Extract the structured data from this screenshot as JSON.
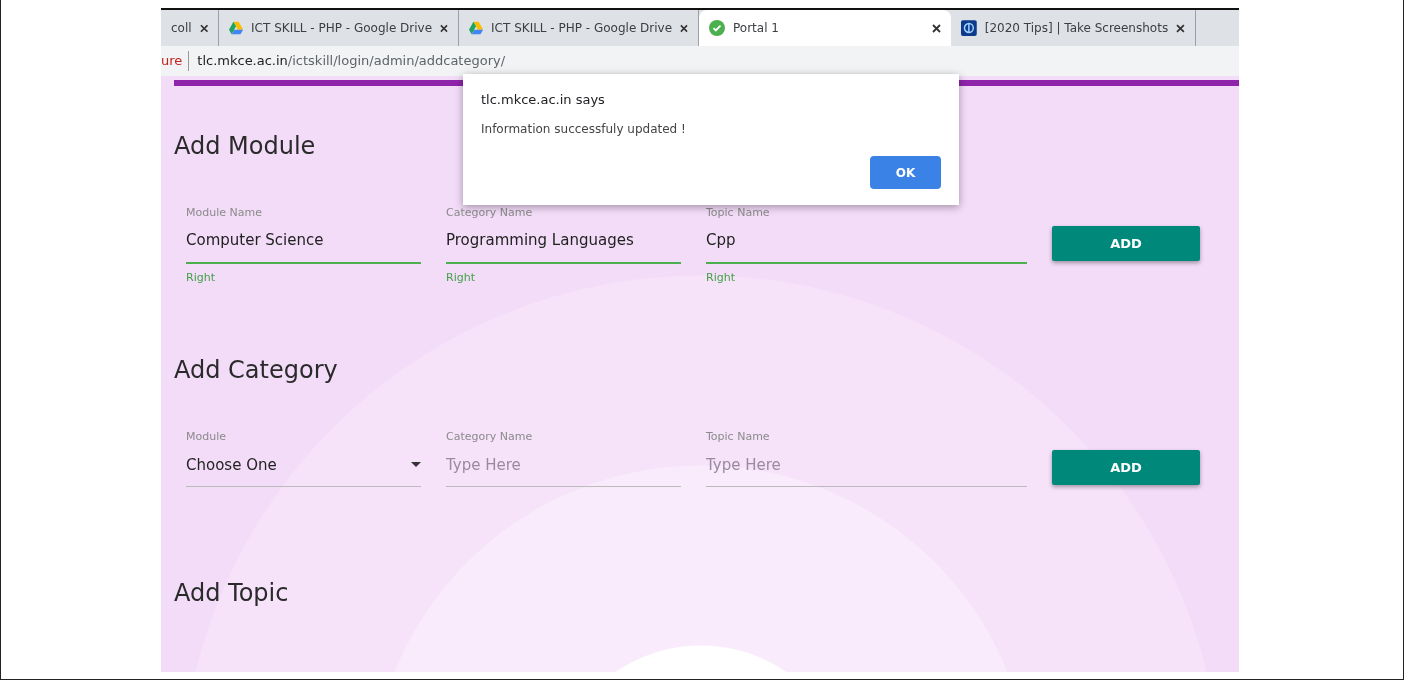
{
  "tabs": [
    {
      "title": "coll",
      "kind": "plain",
      "selected": false
    },
    {
      "title": "ICT SKILL - PHP - Google Drive",
      "kind": "drive",
      "selected": false
    },
    {
      "title": "ICT SKILL - PHP - Google Drive",
      "kind": "drive",
      "selected": false
    },
    {
      "title": "Portal 1",
      "kind": "portal",
      "selected": true
    },
    {
      "title": "[2020 Tips] | Take Screenshots",
      "kind": "site",
      "selected": false
    }
  ],
  "address_bar": {
    "security": "ure",
    "host": "tlc.mkce.ac.in",
    "path": "/ictskill/login/admin/addcategory/"
  },
  "sections": [
    {
      "title": "Add Module",
      "fields": [
        {
          "kind": "input",
          "label": "Module Name",
          "value": "Computer Science",
          "valid": true,
          "helper": "Right"
        },
        {
          "kind": "input",
          "label": "Category Name",
          "value": "Programming Languages",
          "valid": true,
          "helper": "Right"
        },
        {
          "kind": "input",
          "label": "Topic Name",
          "value": "Cpp",
          "valid": true,
          "helper": "Right"
        }
      ],
      "button": "ADD"
    },
    {
      "title": "Add Category",
      "fields": [
        {
          "kind": "select",
          "label": "Module",
          "value": "Choose One",
          "valid": false
        },
        {
          "kind": "input",
          "label": "Category Name",
          "placeholder": "Type Here",
          "valid": false
        },
        {
          "kind": "input",
          "label": "Topic Name",
          "placeholder": "Type Here",
          "valid": false
        }
      ],
      "button": "ADD"
    },
    {
      "title": "Add Topic"
    }
  ],
  "dialog": {
    "title": "tlc.mkce.ac.in says",
    "message": "Information successfuly updated !",
    "button": "OK"
  }
}
